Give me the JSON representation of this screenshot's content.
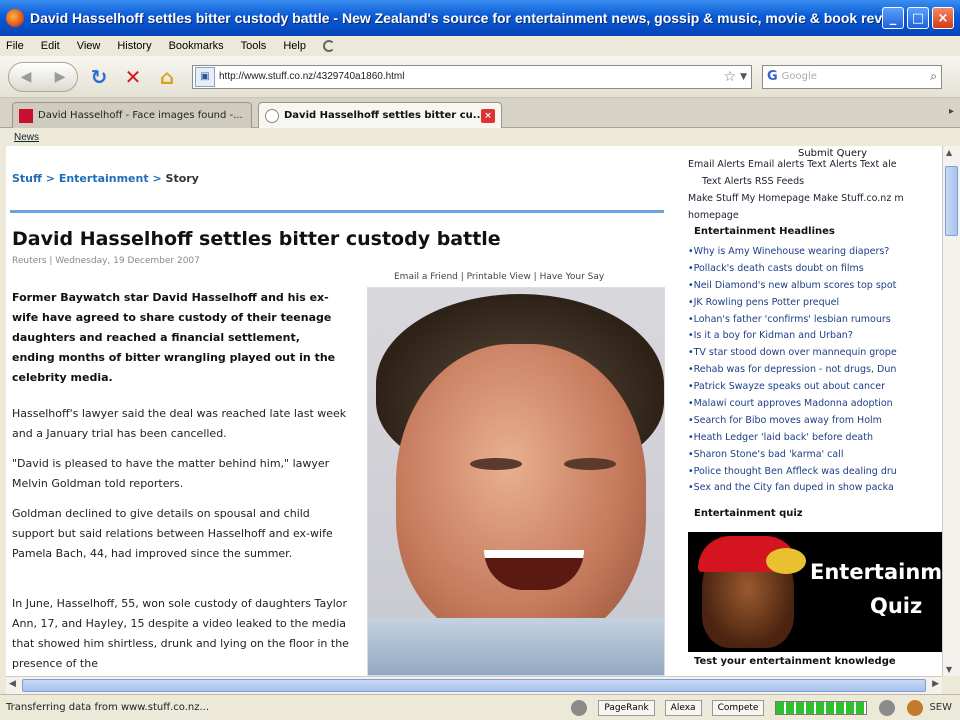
{
  "window": {
    "title": "David Hasselhoff settles bitter custody battle - New Zealand's source for entertainment news, gossip & music, movie & book reviews on St..."
  },
  "menu": [
    "File",
    "Edit",
    "View",
    "History",
    "Bookmarks",
    "Tools",
    "Help"
  ],
  "nav": {
    "url": "http://www.stuff.co.nz/4329740a1860.html",
    "search_placeholder": "Google"
  },
  "tabs": [
    {
      "label": "David Hasselhoff - Face images found -...",
      "active": false
    },
    {
      "label": "David Hasselhoff settles bitter cu...",
      "active": true
    }
  ],
  "bookmarks": [
    "News"
  ],
  "article": {
    "breadcrumb": {
      "home": "Stuff",
      "sep": " > ",
      "section": "Entertainment",
      "current": "Story"
    },
    "headline": "David Hasselhoff settles bitter custody battle",
    "dateline": "Reuters | Wednesday, 19 December 2007",
    "tools": "Email a Friend | Printable View | Have Your Say",
    "lede": "Former Baywatch star David Hasselhoff and his ex-wife have agreed to share custody of their teenage daughters and reached a financial settlement, ending months of bitter wrangling played out in the celebrity media.",
    "paragraphs": [
      "Hasselhoff's lawyer said the deal was reached late last week and a January trial has been cancelled.",
      "\"David is pleased to have the matter behind him,\" lawyer Melvin Goldman told reporters.",
      "Goldman declined to give details on spousal and child support but said relations between Hasselhoff and ex-wife Pamela Bach, 44, had improved since the summer.",
      "In June, Hasselhoff, 55, won sole custody of daughters Taylor Ann, 17, and Hayley, 15 despite a video leaked to the media that showed him shirtless, drunk and lying on the floor in the presence of the"
    ]
  },
  "sidebar": {
    "submit": "Submit Query",
    "links_line1": "Email Alerts Email alerts Text Alerts Text ale",
    "links_line2": "Text Alerts RSS Feeds",
    "links_line3": "Make Stuff My Homepage Make Stuff.co.nz m",
    "links_line4": "homepage",
    "headlines_title": "Entertainment Headlines",
    "headlines": [
      "Why is Amy Winehouse wearing diapers?",
      "Pollack's death casts doubt on films",
      "Neil Diamond's new album scores top spot",
      "JK Rowling pens Potter prequel",
      "Lohan's father 'confirms' lesbian rumours",
      "Is it a boy for Kidman and Urban?",
      "TV star stood down over mannequin grope",
      "Rehab was for depression - not drugs, Dun",
      "Patrick Swayze speaks out about cancer",
      "Malawi court approves Madonna adoption",
      "Search for Bibo moves away from Holm",
      "Heath Ledger 'laid back' before death",
      "Sharon Stone's bad 'karma' call",
      "Police thought Ben Affleck was dealing dru",
      "Sex and the City fan duped in show packa"
    ],
    "quiz_title": "Entertainment quiz",
    "quiz_banner_1": "Entertainme",
    "quiz_banner_2": "Quiz",
    "quiz_test": "Test your entertainment knowledge"
  },
  "status": {
    "message": "Transferring data from www.stuff.co.nz...",
    "pagerank": "PageRank",
    "alexa": "Alexa",
    "compete": "Compete",
    "right": "SEW"
  }
}
